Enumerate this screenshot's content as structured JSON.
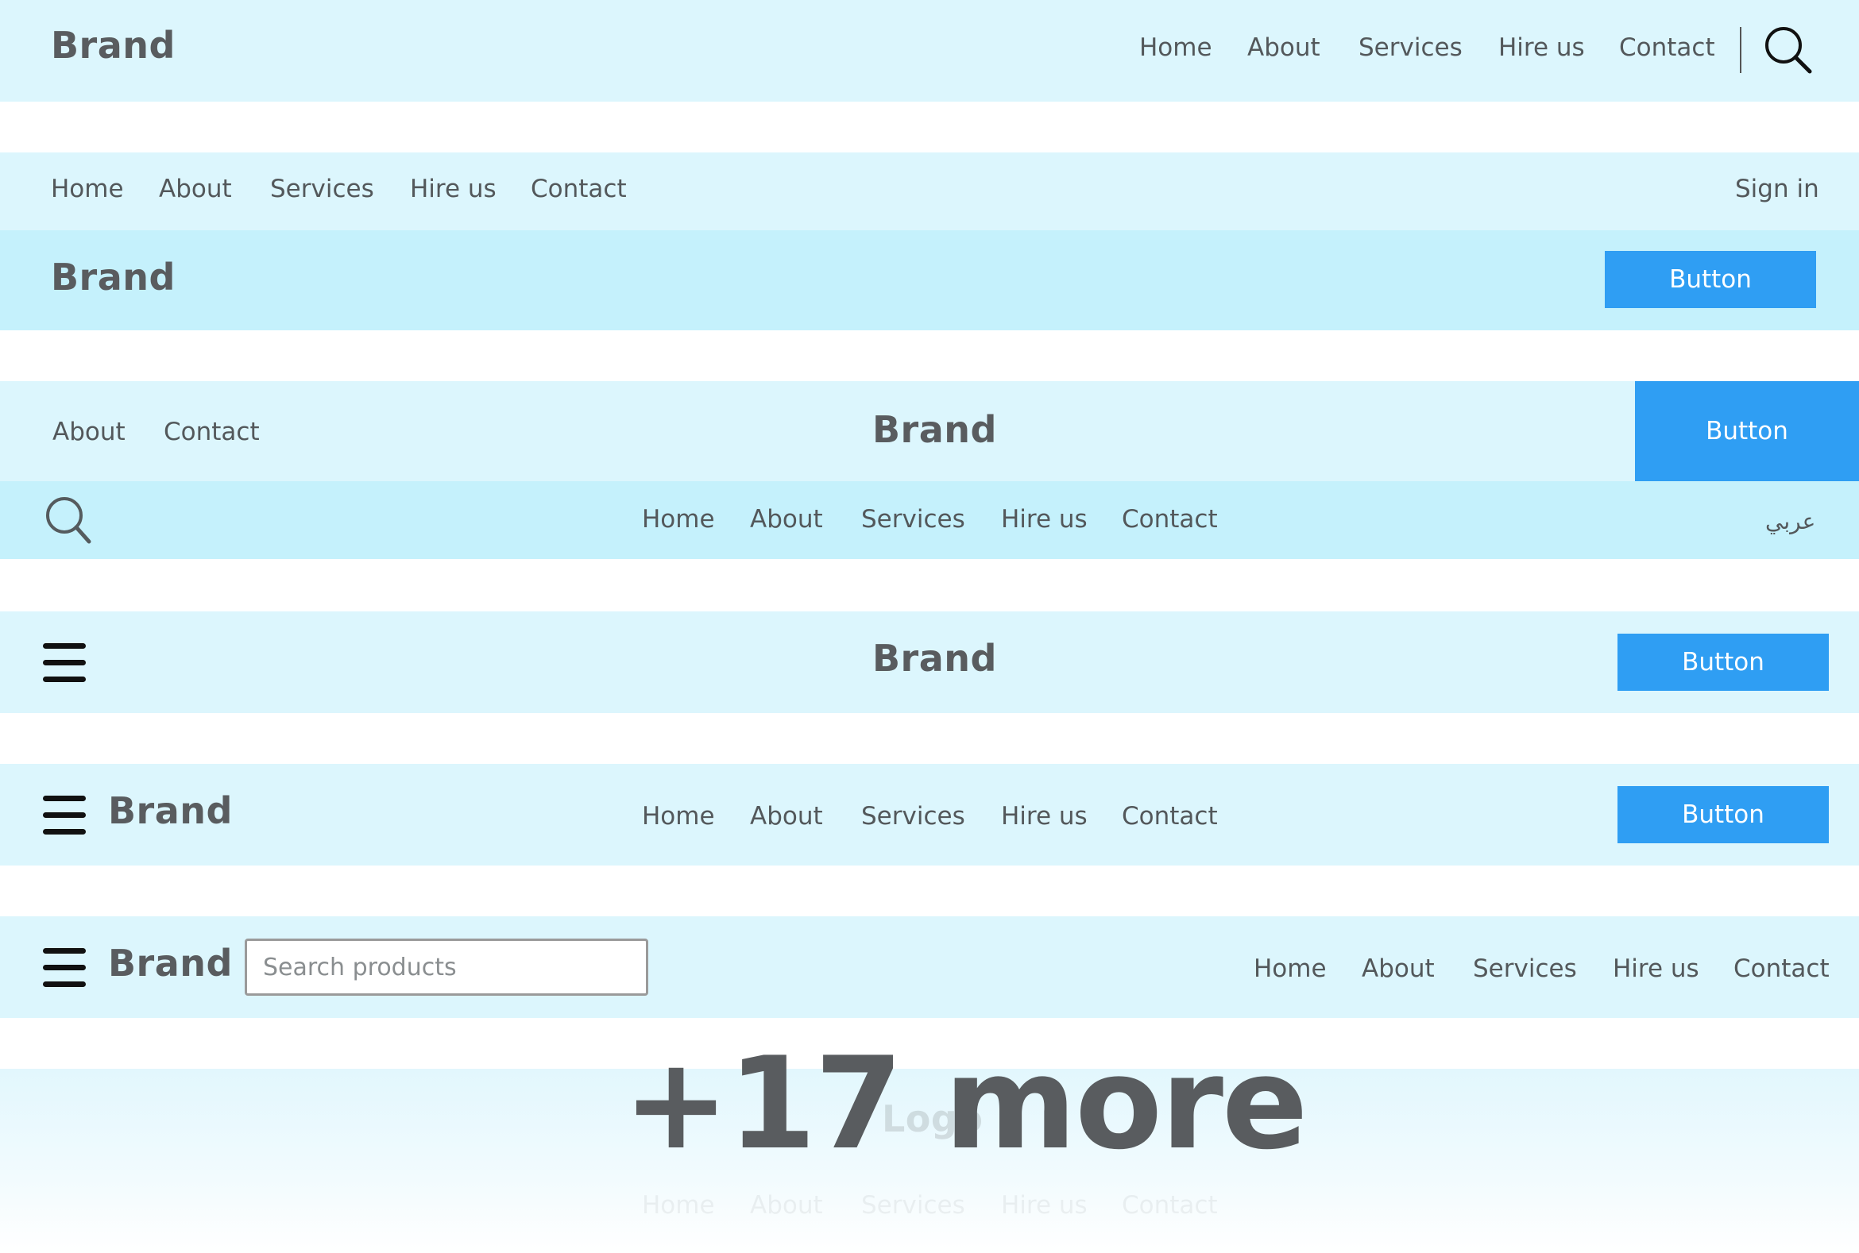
{
  "navbar1": {
    "brand": "Brand",
    "links": [
      "Home",
      "About",
      "Services",
      "Hire us",
      "Contact"
    ],
    "icon": "search-icon"
  },
  "navbar2": {
    "links": [
      "Home",
      "About",
      "Services",
      "Hire us",
      "Contact"
    ],
    "sign_in": "Sign in",
    "brand": "Brand",
    "button": "Button"
  },
  "navbar3": {
    "links_left": [
      "About",
      "Contact"
    ],
    "brand": "Brand",
    "button": "Button",
    "icon": "search-icon",
    "links": [
      "Home",
      "About",
      "Services",
      "Hire us",
      "Contact"
    ],
    "language": "عربي"
  },
  "navbar4": {
    "icon": "hamburger-menu-icon",
    "brand": "Brand",
    "button": "Button"
  },
  "navbar5": {
    "icon": "hamburger-menu-icon",
    "brand": "Brand",
    "links": [
      "Home",
      "About",
      "Services",
      "Hire us",
      "Contact"
    ],
    "button": "Button"
  },
  "navbar6": {
    "icon": "hamburger-menu-icon",
    "brand": "Brand",
    "search_placeholder": "Search products",
    "links": [
      "Home",
      "About",
      "Services",
      "Hire us",
      "Contact"
    ]
  },
  "preview_faded": {
    "logo": "Logo",
    "links": [
      "Home",
      "About",
      "Services",
      "Hire us",
      "Contact"
    ]
  },
  "overlay": {
    "more_label": "+17 more"
  },
  "colors": {
    "bar_light": "#dcf6fd",
    "bar_medium": "#c5f1fc",
    "button_blue": "#2f9ef3",
    "text_gray": "#555b5e"
  }
}
